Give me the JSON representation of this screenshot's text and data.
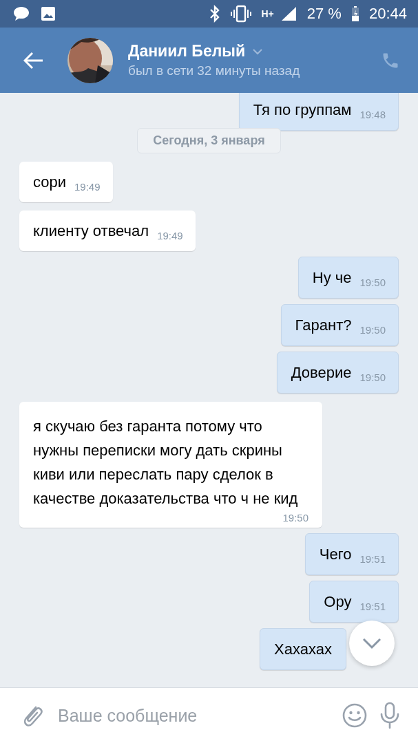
{
  "status_bar": {
    "network": "H+",
    "battery": "27 %",
    "time": "20:44"
  },
  "header": {
    "name": "Даниил Белый",
    "status": "был в сети 32 минуты назад"
  },
  "messages": [
    {
      "kind": "out",
      "text": "Тя по группам",
      "time": "19:48"
    },
    {
      "kind": "date",
      "text": "Сегодня, 3 января"
    },
    {
      "kind": "in",
      "text": "сори",
      "time": "19:49"
    },
    {
      "kind": "in",
      "text": "клиенту отвечал",
      "time": "19:49"
    },
    {
      "kind": "out",
      "text": "Ну че",
      "time": "19:50"
    },
    {
      "kind": "out",
      "text": "Гарант?",
      "time": "19:50"
    },
    {
      "kind": "out",
      "text": "Доверие",
      "time": "19:50"
    },
    {
      "kind": "in",
      "text": "я скучаю без гаранта потому что нужны переписки могу дать скрины киви или переслать пару сделок в качестве доказательства что ч не кид",
      "time": "19:50"
    },
    {
      "kind": "out",
      "text": "Чего",
      "time": "19:51"
    },
    {
      "kind": "out",
      "text": "Ору",
      "time": "19:51"
    },
    {
      "kind": "out",
      "text": "Хахахах"
    }
  ],
  "composer": {
    "placeholder": "Ваше сообщение"
  }
}
